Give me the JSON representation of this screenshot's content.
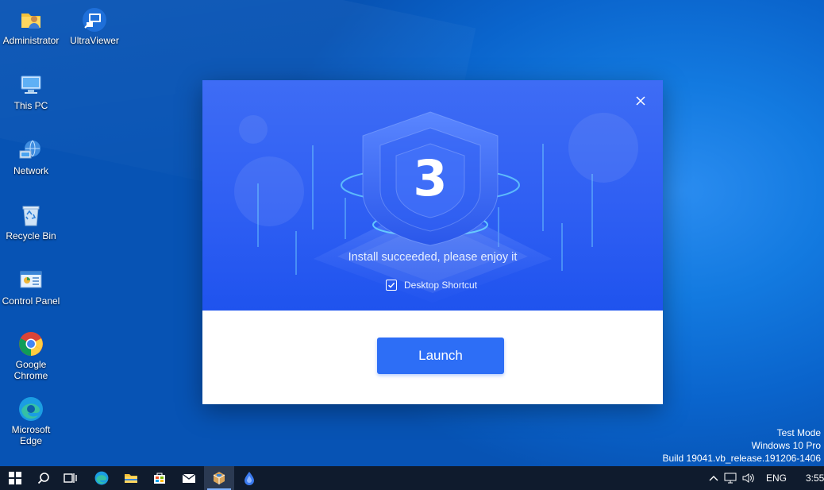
{
  "desktop": {
    "icons": [
      {
        "label": "Administrator",
        "icon": "user-folder-icon"
      },
      {
        "label": "UltraViewer",
        "icon": "ultraviewer-icon"
      },
      {
        "label": "This PC",
        "icon": "computer-icon"
      },
      {
        "label": "Network",
        "icon": "network-icon"
      },
      {
        "label": "Recycle Bin",
        "icon": "recycle-bin-icon"
      },
      {
        "label": "Control Panel",
        "icon": "control-panel-icon"
      },
      {
        "label": "Google Chrome",
        "icon": "chrome-icon"
      },
      {
        "label": "Microsoft Edge",
        "icon": "edge-icon"
      }
    ],
    "watermark": {
      "line1": "Test Mode",
      "line2": "Windows 10 Pro",
      "line3": "Build 19041.vb_release.191206-1406"
    }
  },
  "dialog": {
    "logo_glyph": "3",
    "message": "Install succeeded, please enjoy it",
    "shortcut_label": "Desktop Shortcut",
    "shortcut_checked": true,
    "launch_label": "Launch",
    "close_icon": "close-icon",
    "colors": {
      "hero": "#2f5ff3",
      "button": "#2d6ef6"
    }
  },
  "taskbar": {
    "items": [
      "start-icon",
      "search-icon",
      "task-view-icon",
      "edge-icon",
      "file-explorer-icon",
      "store-icon",
      "mail-icon",
      "installer-icon",
      "app-icon"
    ],
    "tray": {
      "language": "ENG",
      "time": "3:55"
    }
  }
}
